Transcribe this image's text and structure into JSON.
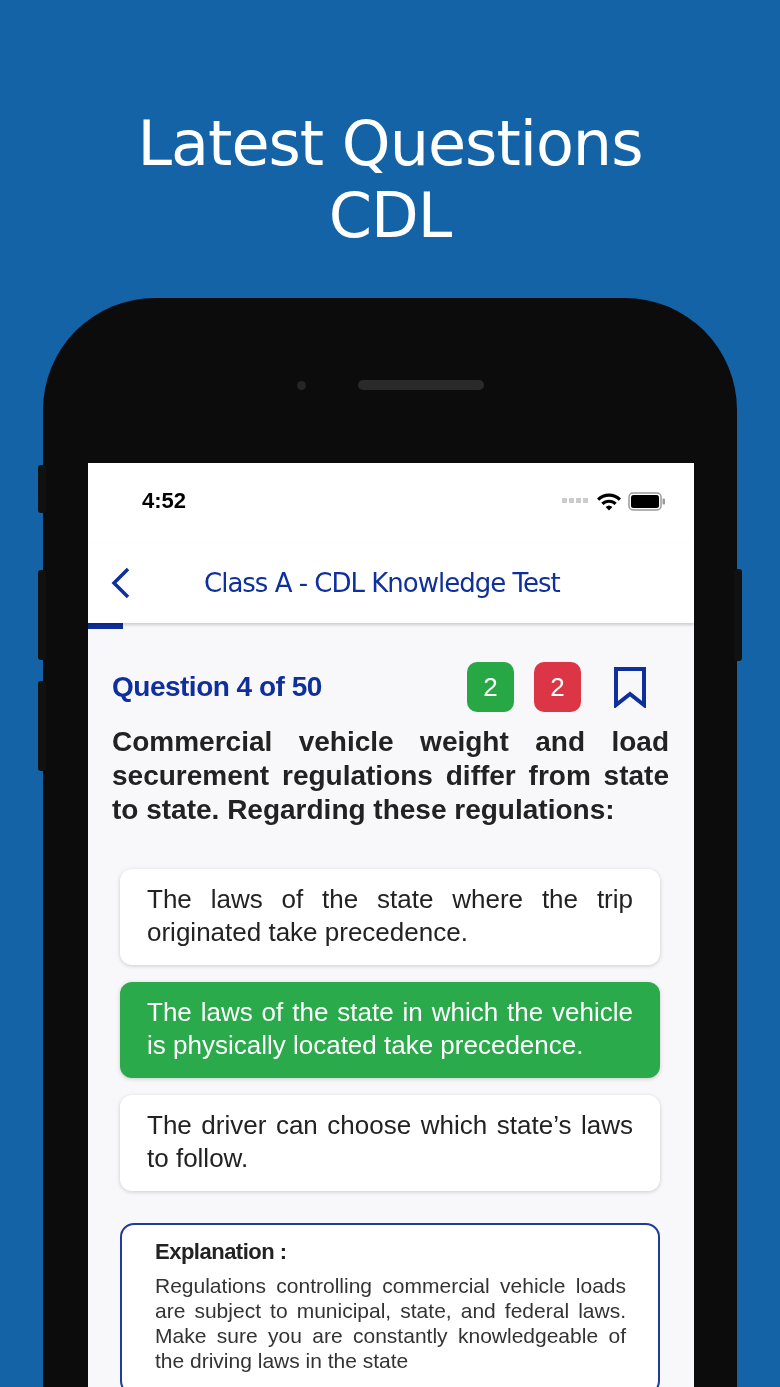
{
  "headline": [
    "Latest Questions",
    "CDL"
  ],
  "status_bar": {
    "time": "4:52"
  },
  "nav": {
    "title": "Class A - CDL Knowledge Test",
    "level": 0.058
  },
  "question": {
    "counter": "Question 4 of 50",
    "correct_count": "2",
    "wrong_count": "2",
    "bookmarked": false,
    "text": "Commercial vehicle weight and load securement regulations differ from state to state. Regarding these regulations:"
  },
  "answers": [
    {
      "text": "The laws of the state where the trip originated take precedence.",
      "selected": false
    },
    {
      "text": "The laws of the state in which the vehicle is physically located take precedence.",
      "selected": true
    },
    {
      "text": "The driver can choose which state’s laws to follow.",
      "selected": false
    }
  ],
  "explanation": {
    "title": "Explanation :",
    "text": "Regulations controlling commercial vehicle loads are subject to municipal, state, and federal laws. Make sure you are constantly knowledgeable of the driving laws in the state"
  }
}
